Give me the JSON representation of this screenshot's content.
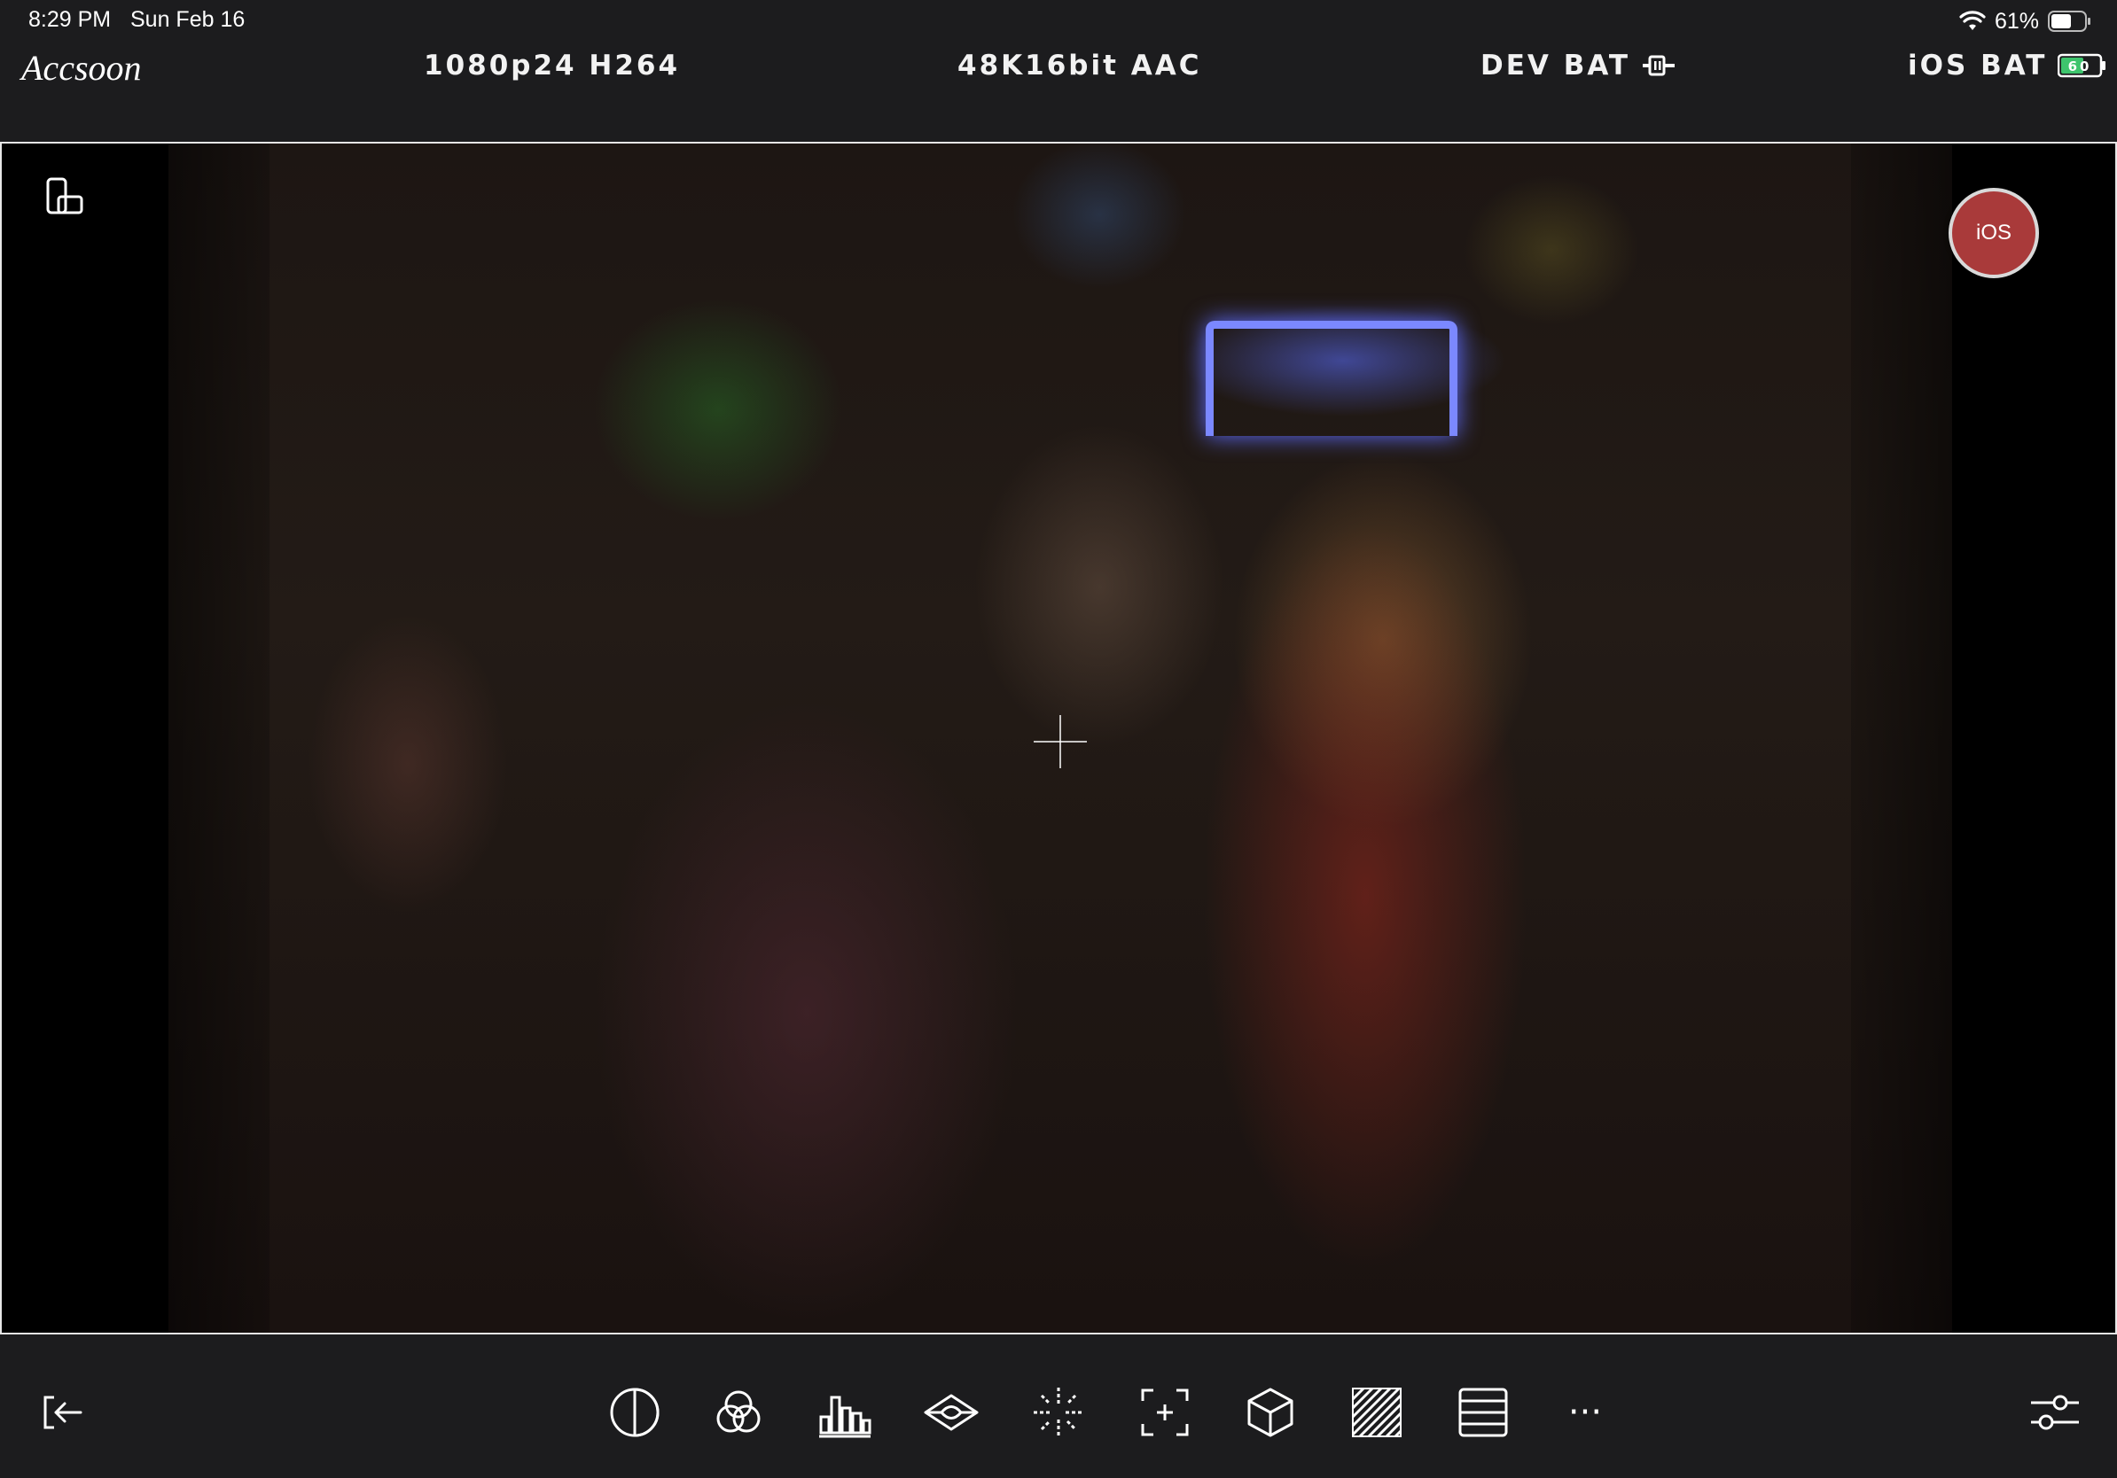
{
  "status_bar": {
    "time": "8:29 PM",
    "date": "Sun Feb 16",
    "battery_percent": "61%",
    "wifi_icon": "wifi-icon",
    "battery_level": 0.61
  },
  "info_bar": {
    "logo_text": "Accsoon",
    "video_format": "1080p24 H264",
    "audio_format": "48K16bit AAC",
    "device_battery_label": "DEV BAT",
    "device_power_icon": "plug-icon",
    "ios_battery_label": "iOS BAT",
    "ios_battery_value": "60",
    "ios_battery_color": "#3ec46d"
  },
  "preview": {
    "rotate_icon": "rotate-device-icon",
    "record_button_label": "iOS",
    "record_button_color": "#a93a3a",
    "crosshair_icon": "crosshair-icon"
  },
  "toolbar": {
    "exit_icon": "exit-icon",
    "tools": [
      "contrast-icon",
      "color-circles-icon",
      "histogram-icon",
      "waveform-icon",
      "focus-peaking-icon",
      "frame-guide-icon",
      "lut-cube-icon",
      "zebra-icon",
      "lines-icon"
    ],
    "more_label": "···",
    "settings_icon": "sliders-icon"
  }
}
